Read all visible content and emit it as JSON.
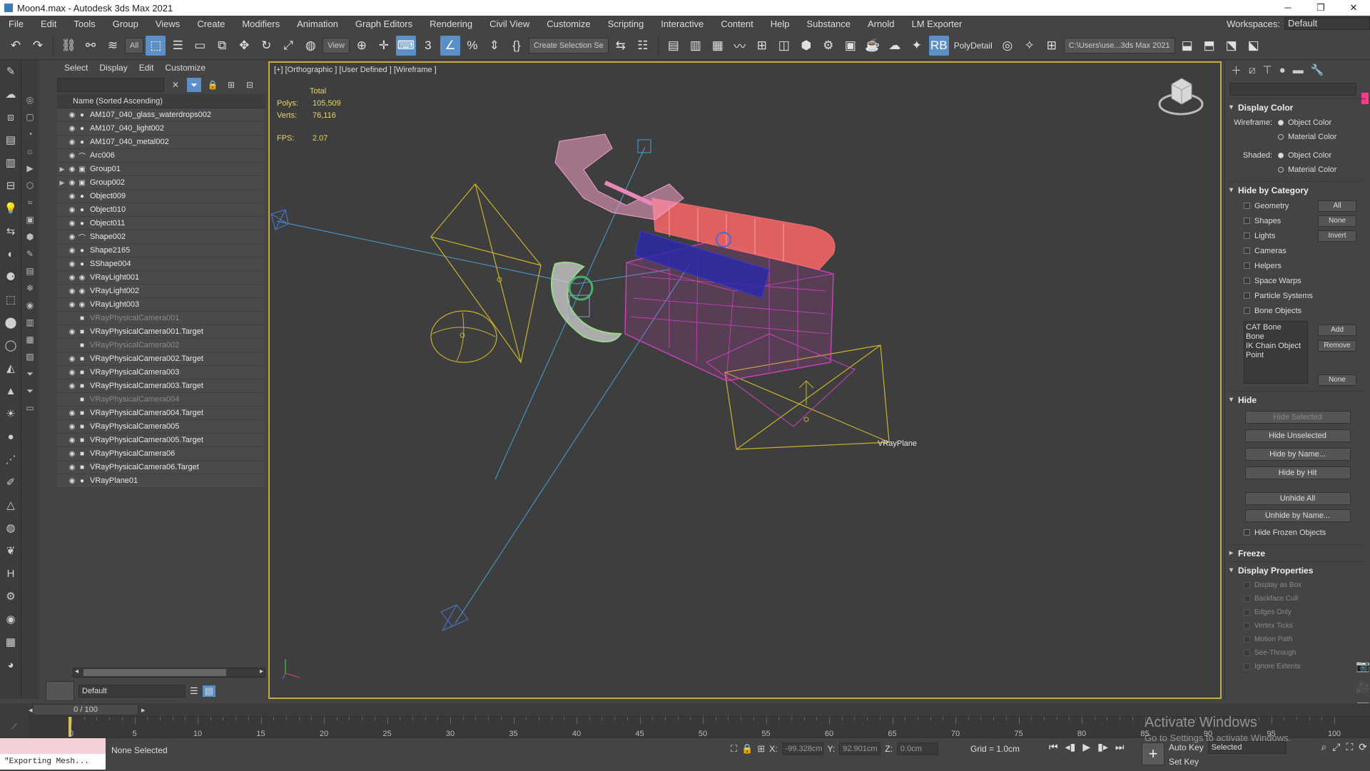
{
  "window": {
    "title": "Moon4.max - Autodesk 3ds Max 2021",
    "controls": [
      "─",
      "❐",
      "✕"
    ]
  },
  "menu": {
    "items": [
      "File",
      "Edit",
      "Tools",
      "Group",
      "Views",
      "Create",
      "Modifiers",
      "Animation",
      "Graph Editors",
      "Rendering",
      "Civil View",
      "Customize",
      "Scripting",
      "Interactive",
      "Content",
      "Help",
      "Substance",
      "Arnold",
      "LM Exporter"
    ],
    "workspaces_label": "Workspaces:",
    "workspaces_value": "Default"
  },
  "toolbar": {
    "filter_value": "All",
    "view_value": "View",
    "selection_set": "Create Selection Se",
    "polydetail": "PolyDetail",
    "path": "C:\\Users\\use...3ds Max 2021"
  },
  "explorer": {
    "menu": [
      "Select",
      "Display",
      "Edit",
      "Customize"
    ],
    "header": "Name (Sorted Ascending)",
    "rows": [
      {
        "name": "AM107_040_glass_waterdrops002",
        "icon": "●"
      },
      {
        "name": "AM107_040_light002",
        "icon": "●"
      },
      {
        "name": "AM107_040_metal002",
        "icon": "●"
      },
      {
        "name": "Arc006",
        "icon": "⌒"
      },
      {
        "name": "Group01",
        "icon": "▣"
      },
      {
        "name": "Group002",
        "icon": "▣"
      },
      {
        "name": "Object009",
        "icon": "●"
      },
      {
        "name": "Object010",
        "icon": "●"
      },
      {
        "name": "Object011",
        "icon": "●"
      },
      {
        "name": "Shape002",
        "icon": "⌒"
      },
      {
        "name": "Shape2165",
        "icon": "●"
      },
      {
        "name": "SShape004",
        "icon": "●"
      },
      {
        "name": "VRayLight001",
        "icon": "◉"
      },
      {
        "name": "VRayLight002",
        "icon": "◉"
      },
      {
        "name": "VRayLight003",
        "icon": "◉"
      },
      {
        "name": "VRayPhysicalCamera001",
        "icon": "■"
      },
      {
        "name": "VRayPhysicalCamera001.Target",
        "icon": "■"
      },
      {
        "name": "VRayPhysicalCamera002",
        "icon": "■"
      },
      {
        "name": "VRayPhysicalCamera002.Target",
        "icon": "■"
      },
      {
        "name": "VRayPhysicalCamera003",
        "icon": "■"
      },
      {
        "name": "VRayPhysicalCamera003.Target",
        "icon": "■"
      },
      {
        "name": "VRayPhysicalCamera004",
        "icon": "■"
      },
      {
        "name": "VRayPhysicalCamera004.Target",
        "icon": "■"
      },
      {
        "name": "VRayPhysicalCamera005",
        "icon": "■"
      },
      {
        "name": "VRayPhysicalCamera005.Target",
        "icon": "■"
      },
      {
        "name": "VRayPhysicalCamera06",
        "icon": "■"
      },
      {
        "name": "VRayPhysicalCamera06.Target",
        "icon": "■"
      },
      {
        "name": "VRayPlane01",
        "icon": "●"
      }
    ],
    "layer": "Default"
  },
  "viewport": {
    "label": "[+] [Orthographic ] [User Defined ] [Wireframe ]",
    "stats_total": "Total",
    "polys_label": "Polys:",
    "polys_value": "105,509",
    "verts_label": "Verts:",
    "verts_value": "76,116",
    "fps_label": "FPS:",
    "fps_value": "2.07",
    "plane_label": "VRayPlane"
  },
  "command_panel": {
    "display_color": {
      "title": "Display Color",
      "wireframe_label": "Wireframe:",
      "shaded_label": "Shaded:",
      "object_color": "Object Color",
      "material_color": "Material Color"
    },
    "hide_by_category": {
      "title": "Hide by Category",
      "categories": [
        "Geometry",
        "Shapes",
        "Lights",
        "Cameras",
        "Helpers",
        "Space Warps",
        "Particle Systems",
        "Bone Objects"
      ],
      "btn_all": "All",
      "btn_none": "None",
      "btn_invert": "Invert",
      "list": [
        "CAT Bone",
        "Bone",
        "IK Chain Object",
        "Point"
      ],
      "btn_add": "Add",
      "btn_remove": "Remove",
      "btn_none2": "None"
    },
    "hide": {
      "title": "Hide",
      "buttons": [
        "Hide Selected",
        "Hide Unselected",
        "Hide by Name...",
        "Hide by Hit",
        "Unhide All",
        "Unhide by Name..."
      ],
      "hide_frozen": "Hide Frozen Objects"
    },
    "freeze": {
      "title": "Freeze"
    },
    "display_properties": {
      "title": "Display Properties",
      "items": [
        "Display as Box",
        "Backface Cull",
        "Edges Only",
        "Vertex Ticks",
        "Motion Path",
        "See-Through",
        "Ignore Extents"
      ]
    }
  },
  "timeline": {
    "frame_display": "0 / 100",
    "ticks": [
      0,
      5,
      10,
      15,
      20,
      25,
      30,
      35,
      40,
      45,
      50,
      55,
      60,
      65,
      70,
      75,
      80,
      85,
      90,
      95,
      100
    ]
  },
  "status": {
    "maxscript": "\"Exporting Mesh...",
    "selection": "None Selected",
    "x_label": "X:",
    "x_value": "-99.328cm",
    "y_label": "Y:",
    "y_value": "92.901cm",
    "z_label": "Z:",
    "z_value": "0.0cm",
    "grid": "Grid = 1.0cm",
    "auto_key": "Auto Key",
    "auto_key_value": "Selected",
    "set_key": "Set Key"
  },
  "watermark": {
    "line1": "Activate Windows",
    "line2": "Go to Settings to activate Windows."
  },
  "colors": {
    "accent": "#5b8fc8",
    "viewport_border": "#c6a74a",
    "camera_wire": "#c8b42a",
    "light_wire": "#4aa0d8",
    "magenta_wire": "#d040c0",
    "red_wire": "#f06a6a",
    "pink_wire": "#f4a0c8",
    "blue_wire": "#2a2aa8",
    "green_wire": "#9ad88a"
  }
}
